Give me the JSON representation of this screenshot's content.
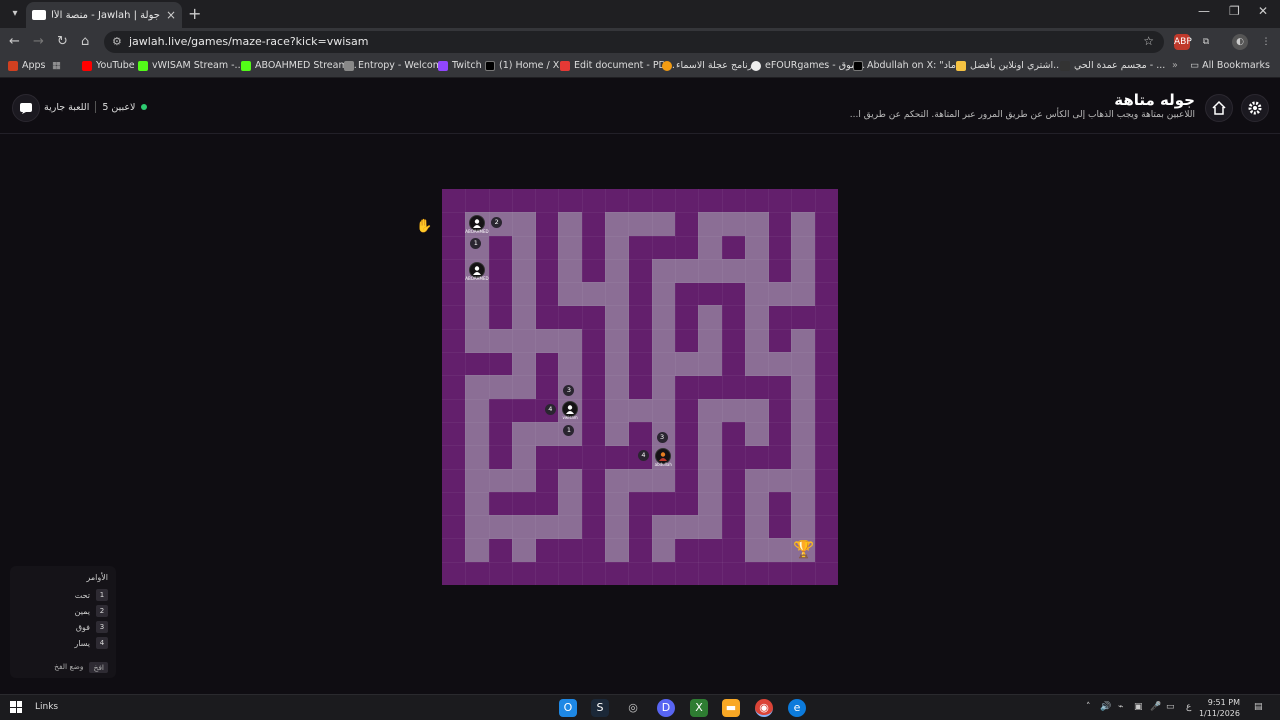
{
  "browser": {
    "tab_title": "جولة | Jawlah - منصة الألعاب الت...",
    "url": "jawlah.live/games/maze-race?kick=vwisam",
    "bookmarks": [
      "Apps",
      "YouTube",
      "vWISAM Stream -...",
      "ABOAHMED Stream...",
      "Entropy - Welcome",
      "Twitch",
      "(1) Home / X",
      "Edit document - PD...",
      "برنامج عجلة الاسماء",
      "eFOURgames - موق...",
      "Abdullah on X: \"ماد...",
      "اشتري اونلاين بأفضل...",
      "مجسم عمدة الحي - ..."
    ],
    "all_bookmarks": "All Bookmarks"
  },
  "header": {
    "title": "جوله متاهة",
    "description": "اللاعبين بمتاهة ويجب الذهاب إلى الكأس عن طريق المرور عبر المتاهة. التحكم عن طريق ا...",
    "status_players": "5 لاعبين",
    "status_game": "اللعبة جارية"
  },
  "maze": {
    "grid_size": 17,
    "wall_color": "#631f6c",
    "path_color": "#8b6e95",
    "rows": [
      "#################",
      "#...#.#...#...#.#",
      "#.#.#.#.###.#.#.#",
      "#.#.#.#.#.....#.#",
      "#.#.#...#.###...#",
      "#.#.###.#.#.#.###",
      "#.....#.#.#.#.#.#",
      "###.#.#.#...#...#",
      "#...#.#.#.#####.#",
      "#.###.#...#...#.#",
      "#.#...#.#.#.#.#.#",
      "#.#.#####.#.###.#",
      "#...#.#...#.#...#",
      "#.###.#.###.#.#.#",
      "#.....#.#...#.#.#",
      "#.#.###.#.###...#",
      "#################"
    ],
    "players": [
      {
        "name": "ABOAHMED",
        "row": 1,
        "col": 1,
        "hints": [
          "2",
          "1"
        ]
      },
      {
        "name": "ABOAHMED",
        "row": 3,
        "col": 1,
        "hints": []
      },
      {
        "name": "vwisam",
        "row": 9,
        "col": 5,
        "hints": [
          "3",
          "4",
          "1"
        ]
      },
      {
        "name": "abdullah",
        "row": 11,
        "col": 9,
        "hints": [
          "3",
          "4"
        ]
      }
    ]
  },
  "commands": {
    "title": "الأوامر",
    "items": [
      {
        "key": "1",
        "label": "تحت"
      },
      {
        "key": "2",
        "label": "يمين"
      },
      {
        "key": "3",
        "label": "فوق"
      },
      {
        "key": "4",
        "label": "يسار"
      }
    ],
    "foot_label": "وضع الفخ",
    "foot_key": "افخ"
  },
  "taskbar": {
    "links": "Links",
    "time": "9:51 PM",
    "date": "1/11/2026",
    "lang": "ع"
  }
}
